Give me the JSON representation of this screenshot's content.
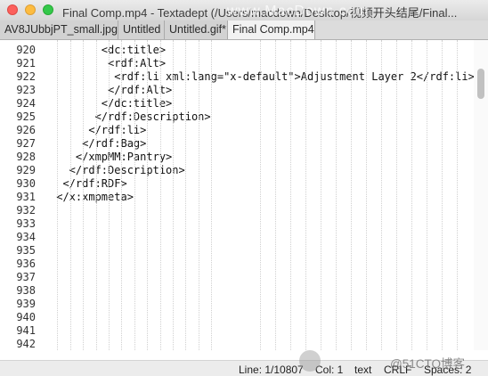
{
  "window": {
    "title": "Final Comp.mp4 - Textadept (/Users/macdown/Desktop/视频开头结尾/Final..."
  },
  "tabs": [
    {
      "label": "AV8JUbbjPT_small.jpg",
      "active": false
    },
    {
      "label": "Untitled",
      "active": false
    },
    {
      "label": "Untitled.gif*",
      "active": false
    },
    {
      "label": "Final Comp.mp4",
      "active": true
    }
  ],
  "editor": {
    "lines": [
      {
        "number": "920",
        "text": "        <dc:title>"
      },
      {
        "number": "921",
        "text": "         <rdf:Alt>"
      },
      {
        "number": "922",
        "text": "          <rdf:li xml:lang=\"x-default\">Adjustment Layer 2</rdf:li>"
      },
      {
        "number": "923",
        "text": "         </rdf:Alt>"
      },
      {
        "number": "924",
        "text": "        </dc:title>"
      },
      {
        "number": "925",
        "text": "       </rdf:Description>"
      },
      {
        "number": "926",
        "text": "      </rdf:li>"
      },
      {
        "number": "927",
        "text": "     </rdf:Bag>"
      },
      {
        "number": "928",
        "text": "    </xmpMM:Pantry>"
      },
      {
        "number": "929",
        "text": "   </rdf:Description>"
      },
      {
        "number": "930",
        "text": "  </rdf:RDF>"
      },
      {
        "number": "931",
        "text": " </x:xmpmeta>"
      },
      {
        "number": "932",
        "text": ""
      },
      {
        "number": "933",
        "text": ""
      },
      {
        "number": "934",
        "text": ""
      },
      {
        "number": "935",
        "text": ""
      },
      {
        "number": "936",
        "text": ""
      },
      {
        "number": "937",
        "text": ""
      },
      {
        "number": "938",
        "text": ""
      },
      {
        "number": "939",
        "text": ""
      },
      {
        "number": "940",
        "text": ""
      },
      {
        "number": "941",
        "text": ""
      },
      {
        "number": "942",
        "text": ""
      }
    ]
  },
  "statusbar": {
    "line": "Line: 1/10807",
    "col": "Col: 1",
    "lexer": "text",
    "eol": "CRLF",
    "indent": "Spaces: 2"
  },
  "watermarks": {
    "top": "www.MacDown.com",
    "bottom": "@51CTO博客"
  }
}
